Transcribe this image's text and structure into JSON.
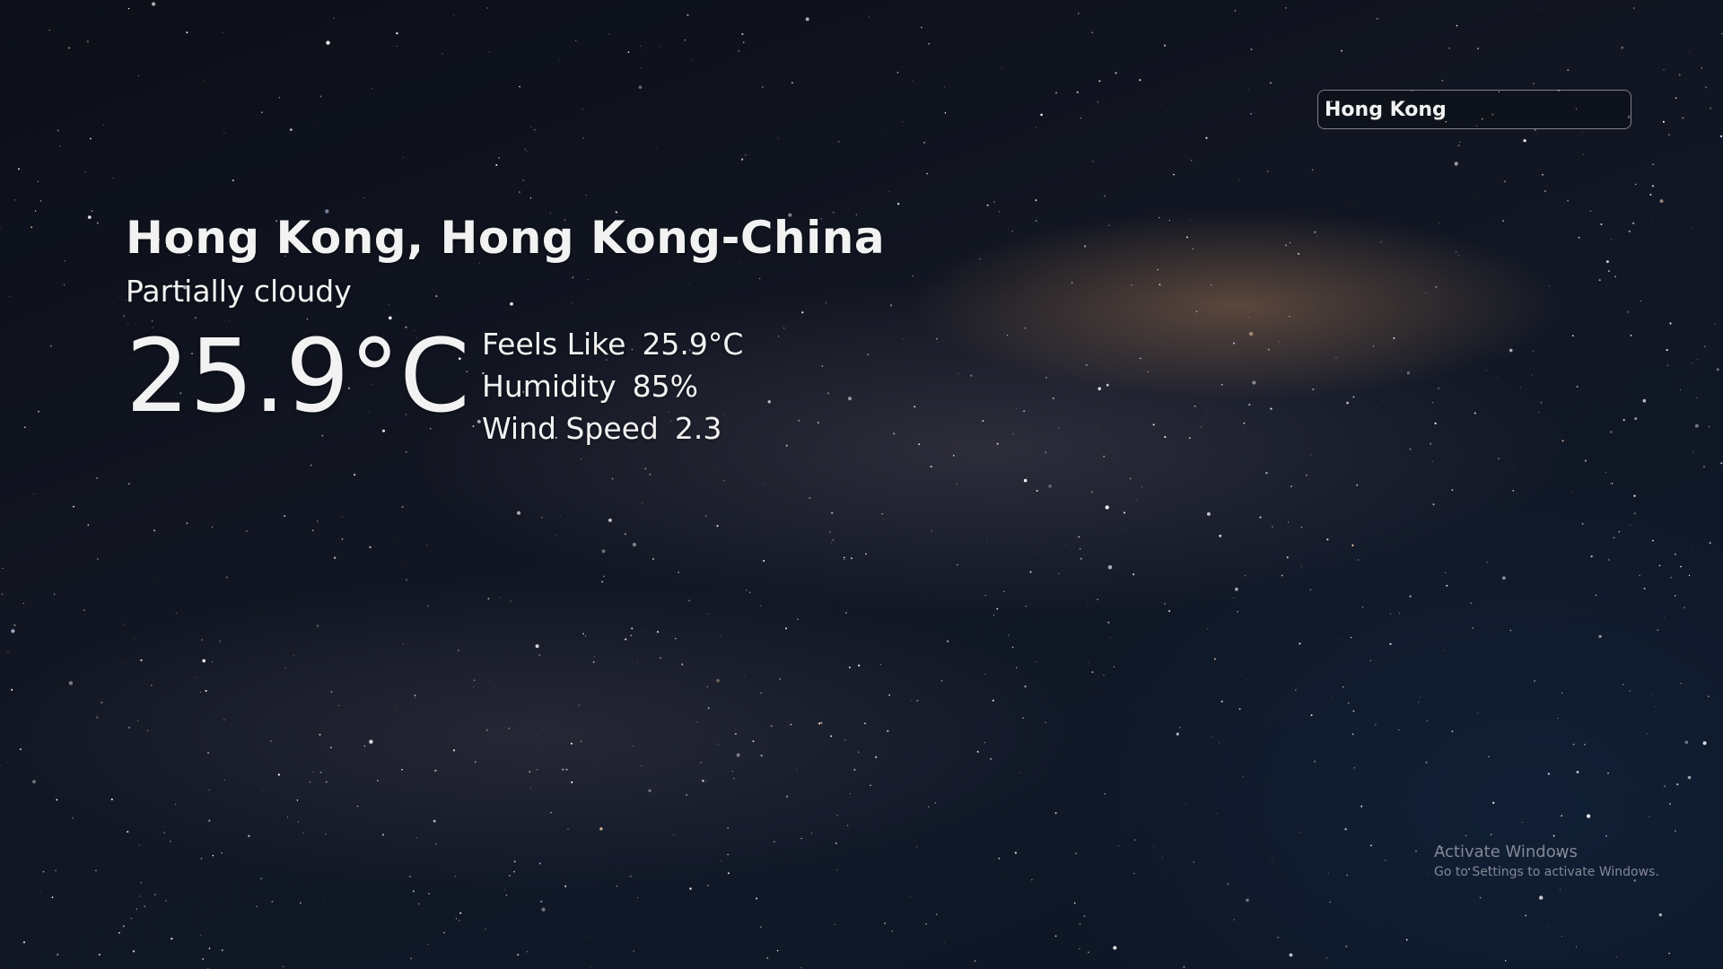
{
  "search": {
    "value": "Hong Kong"
  },
  "weather": {
    "location": "Hong Kong, Hong Kong-China",
    "condition": "Partially cloudy",
    "temperature": "25.9°C",
    "details": [
      {
        "label": "Feels Like",
        "value": "25.9°C"
      },
      {
        "label": "Humidity",
        "value": "85%"
      },
      {
        "label": "Wind Speed",
        "value": "2.3"
      }
    ]
  },
  "watermark": {
    "title": "Activate Windows",
    "subtitle": "Go to Settings to activate Windows."
  },
  "colors": {
    "text": "#f2f2f2",
    "background": "#101521",
    "search_border": "#dcdce6"
  },
  "background_image": "night-sky-milky-way"
}
